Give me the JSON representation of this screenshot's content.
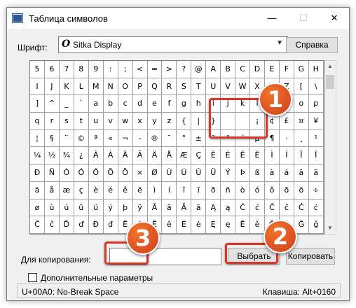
{
  "window": {
    "title": "Таблица символов",
    "controls": {
      "minimize": "—",
      "maximize": "☐",
      "close": "✕"
    }
  },
  "font": {
    "label": "Шрифт:",
    "icon_glyph": "O",
    "value": "Sitka Display",
    "dropdown_glyph": "▼",
    "help_button": "Справка"
  },
  "grid_rows": [
    [
      "5",
      "6",
      "7",
      "8",
      "9",
      ":",
      ";",
      "<",
      "=",
      ">",
      "?",
      "@",
      "A",
      "B",
      "C",
      "D",
      "E",
      "F",
      "G",
      "H"
    ],
    [
      "I",
      "J",
      "K",
      "L",
      "M",
      "N",
      "O",
      "P",
      "Q",
      "R",
      "S",
      "T",
      "U",
      "V",
      "W",
      "X",
      "Y",
      "Z",
      "[",
      "\\"
    ],
    [
      "]",
      "^",
      "_",
      "`",
      "a",
      "b",
      "c",
      "d",
      "e",
      "f",
      "g",
      "h",
      "i",
      "j",
      "k",
      "l",
      "m",
      "n",
      "o",
      "p"
    ],
    [
      "q",
      "r",
      "s",
      "t",
      "u",
      "v",
      "w",
      "x",
      "y",
      "z",
      "{",
      "|",
      "}",
      "",
      "",
      "¡",
      "¢",
      "£",
      "¤",
      "¥"
    ],
    [
      "¦",
      "§",
      "¨",
      "©",
      "ª",
      "«",
      "¬",
      "-",
      "®",
      "¯",
      "°",
      "±",
      "²",
      "³",
      "´",
      "µ",
      "¶",
      "·",
      "¸",
      "¹"
    ],
    [
      "¼",
      "½",
      "¾",
      "¿",
      "À",
      "Á",
      "Â",
      "Ã",
      "Ä",
      "Å",
      "Æ",
      "Ç",
      "È",
      "É",
      "Ê",
      "Ë",
      "Ì",
      "Í",
      "Î",
      "Ï"
    ],
    [
      "Ð",
      "Ñ",
      "Ò",
      "Ó",
      "Ô",
      "Õ",
      "Ö",
      "×",
      "Ø",
      "Ù",
      "Ú",
      "Û",
      "Ü",
      "Ý",
      "Þ",
      "ß",
      "à",
      "á",
      "â",
      "ã"
    ],
    [
      "ä",
      "å",
      "æ",
      "ç",
      "è",
      "é",
      "ê",
      "ë",
      "ì",
      "í",
      "î",
      "ï",
      "ð",
      "ñ",
      "ò",
      "ó",
      "ô",
      "õ",
      "ö",
      "÷"
    ],
    [
      "ø",
      "ù",
      "ú",
      "û",
      "ü",
      "ý",
      "þ",
      "ÿ",
      "Ā",
      "ā",
      "Ă",
      "ă",
      "Ą",
      "ą",
      "Ć",
      "ć",
      "Ĉ",
      "ĉ",
      "Ċ",
      "ċ"
    ],
    [
      "Č",
      "č",
      "Ď",
      "ď",
      "Đ",
      "đ",
      "Ē",
      "ē",
      "Ĕ",
      "ĕ",
      "Ė",
      "ė",
      "Ę",
      "ę",
      "Ě",
      "ě",
      "Ĝ",
      "ĝ",
      "Ğ",
      "ğ"
    ]
  ],
  "scrollbar": {
    "up_glyph": "▲",
    "down_glyph": "▼"
  },
  "copy": {
    "label": "Для копирования:",
    "value": "",
    "select_button": "Выбрать",
    "copy_button": "Копировать"
  },
  "advanced": {
    "label": "Дополнительные параметры",
    "checked": false
  },
  "status": {
    "char_info": "U+00A0: No-Break Space",
    "key_info": "Клавиша: Alt+0160"
  },
  "annotations": {
    "color": "#d9362b",
    "badge_color": "#e05525",
    "badges": [
      "1",
      "2",
      "3"
    ]
  }
}
